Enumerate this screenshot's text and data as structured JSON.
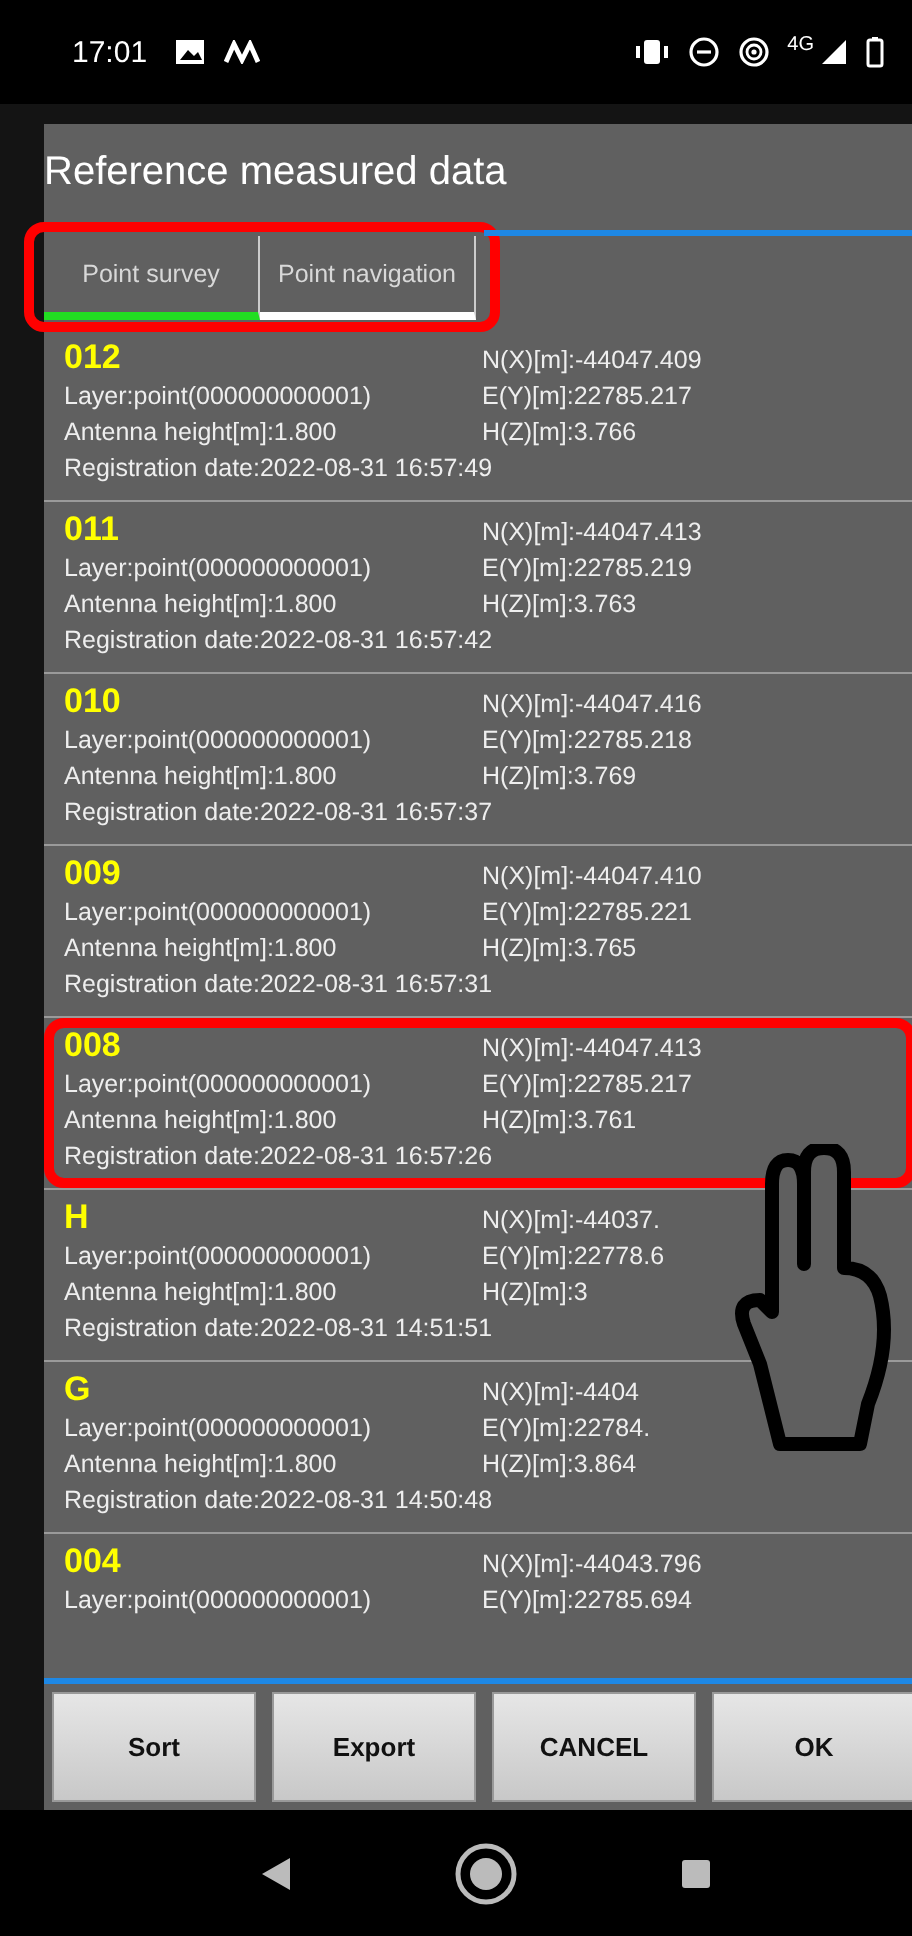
{
  "status_bar": {
    "time": "17:01",
    "network": "4G"
  },
  "dialog": {
    "title": "Reference measured data",
    "tab_bar": {
      "highlighted": true,
      "tabs": [
        {
          "label": "Point survey",
          "selected": true
        },
        {
          "label": "Point navigation",
          "selected": false
        }
      ]
    },
    "rows": [
      {
        "name": "012",
        "layer": "Layer:point(000000000001)",
        "antenna": "Antenna height[m]:1.800",
        "date": "Registration date:2022-08-31 16:57:49",
        "n": "N(X)[m]:-44047.409",
        "e": "E(Y)[m]:22785.217",
        "h": "H(Z)[m]:3.766",
        "highlighted": false
      },
      {
        "name": "011",
        "layer": "Layer:point(000000000001)",
        "antenna": "Antenna height[m]:1.800",
        "date": "Registration date:2022-08-31 16:57:42",
        "n": "N(X)[m]:-44047.413",
        "e": "E(Y)[m]:22785.219",
        "h": "H(Z)[m]:3.763",
        "highlighted": false
      },
      {
        "name": "010",
        "layer": "Layer:point(000000000001)",
        "antenna": "Antenna height[m]:1.800",
        "date": "Registration date:2022-08-31 16:57:37",
        "n": "N(X)[m]:-44047.416",
        "e": "E(Y)[m]:22785.218",
        "h": "H(Z)[m]:3.769",
        "highlighted": false
      },
      {
        "name": "009",
        "layer": "Layer:point(000000000001)",
        "antenna": "Antenna height[m]:1.800",
        "date": "Registration date:2022-08-31 16:57:31",
        "n": "N(X)[m]:-44047.410",
        "e": "E(Y)[m]:22785.221",
        "h": "H(Z)[m]:3.765",
        "highlighted": false
      },
      {
        "name": "008",
        "layer": "Layer:point(000000000001)",
        "antenna": "Antenna height[m]:1.800",
        "date": "Registration date:2022-08-31 16:57:26",
        "n": "N(X)[m]:-44047.413",
        "e": "E(Y)[m]:22785.217",
        "h": "H(Z)[m]:3.761",
        "highlighted": true
      },
      {
        "name": "H",
        "layer": "Layer:point(000000000001)",
        "antenna": "Antenna height[m]:1.800",
        "date": "Registration date:2022-08-31 14:51:51",
        "n": "N(X)[m]:-44037.",
        "e": "E(Y)[m]:22778.6",
        "h": "H(Z)[m]:3",
        "highlighted": false
      },
      {
        "name": "G",
        "layer": "Layer:point(000000000001)",
        "antenna": "Antenna height[m]:1.800",
        "date": "Registration date:2022-08-31 14:50:48",
        "n": "N(X)[m]:-4404",
        "e": "E(Y)[m]:22784.",
        "h": "H(Z)[m]:3.864",
        "highlighted": false
      },
      {
        "name": "004",
        "layer": "Layer:point(000000000001)",
        "n": "N(X)[m]:-44043.796",
        "e": "E(Y)[m]:22785.694",
        "highlighted": false
      }
    ],
    "buttons": [
      "Sort",
      "Export",
      "CANCEL",
      "OK"
    ]
  }
}
